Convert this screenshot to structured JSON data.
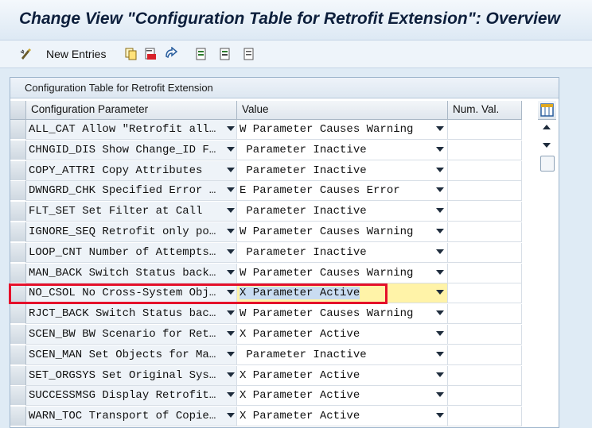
{
  "window": {
    "title": "Change View \"Configuration Table for Retrofit Extension\": Overview"
  },
  "toolbar": {
    "new_entries_label": "New Entries",
    "icons": [
      "new-entries-icon",
      "copy-icon",
      "delete-icon",
      "undo-icon",
      "select-all-icon",
      "select-block-icon",
      "deselect-all-icon"
    ]
  },
  "table": {
    "title": "Configuration Table for Retrofit Extension",
    "columns": {
      "param": "Configuration Parameter",
      "value": "Value",
      "num": "Num. Val."
    },
    "selected_row": 8,
    "highlight_color": "#e5102a",
    "rows": [
      {
        "param": "ALL_CAT Allow \"Retrofit all…",
        "value": "W Parameter Causes Warning",
        "num": ""
      },
      {
        "param": "CHNGID_DIS Show Change_ID F…",
        "value": " Parameter Inactive",
        "num": ""
      },
      {
        "param": "COPY_ATTRI Copy Attributes",
        "value": " Parameter Inactive",
        "num": ""
      },
      {
        "param": "DWNGRD_CHK Specified Error …",
        "value": "E Parameter Causes Error",
        "num": ""
      },
      {
        "param": "FLT_SET Set Filter at Call",
        "value": " Parameter Inactive",
        "num": ""
      },
      {
        "param": "IGNORE_SEQ Retrofit only po…",
        "value": "W Parameter Causes Warning",
        "num": ""
      },
      {
        "param": "LOOP_CNT Number of Attempts…",
        "value": " Parameter Inactive",
        "num": ""
      },
      {
        "param": "MAN_BACK Switch Status back…",
        "value": "W Parameter Causes Warning",
        "num": ""
      },
      {
        "param": "NO_CSOL No Cross-System Obj…",
        "value": "X Parameter Active",
        "num": ""
      },
      {
        "param": "RJCT_BACK Switch Status bac…",
        "value": "W Parameter Causes Warning",
        "num": ""
      },
      {
        "param": "SCEN_BW BW Scenario for Ret…",
        "value": "X Parameter Active",
        "num": ""
      },
      {
        "param": "SCEN_MAN Set Objects for Ma…",
        "value": " Parameter Inactive",
        "num": ""
      },
      {
        "param": "SET_ORGSYS Set Original Sys…",
        "value": "X Parameter Active",
        "num": ""
      },
      {
        "param": "SUCCESSMSG Display Retrofit…",
        "value": "X Parameter Active",
        "num": ""
      },
      {
        "param": "WARN_TOC Transport of Copie…",
        "value": "X Parameter Active",
        "num": ""
      }
    ]
  }
}
